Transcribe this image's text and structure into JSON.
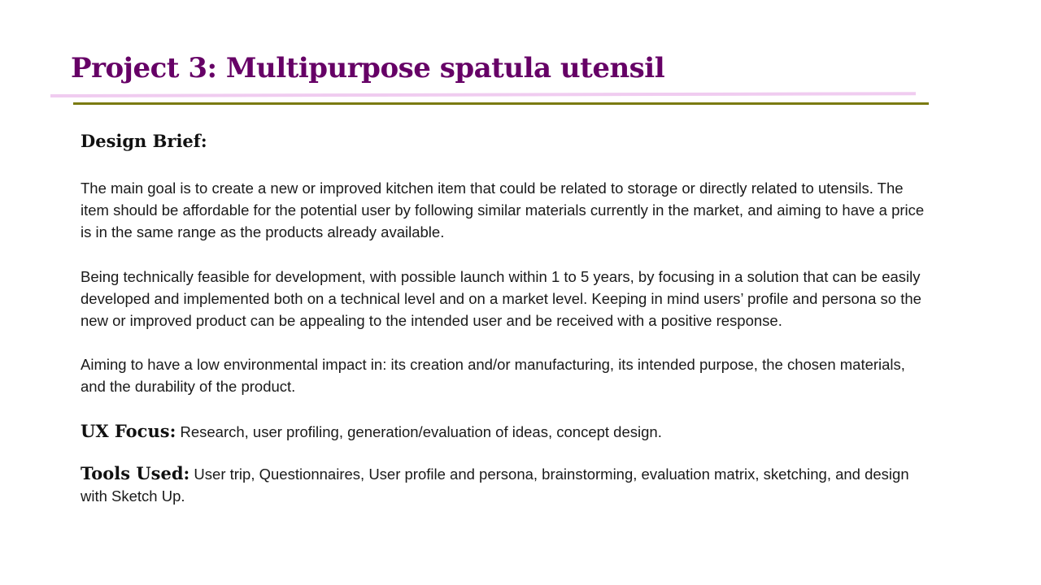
{
  "slide": {
    "title": "Project 3: Multipurpose spatula utensil",
    "design_brief": {
      "heading": "Design Brief:",
      "paragraphs": [
        "The main goal is to create a new or improved kitchen item that could be related to storage or directly related to utensils. The item should be affordable for the potential user by following similar materials currently in the market, and aiming to have a price is in the same range as the products already available.",
        "Being technically feasible for development, with possible launch within 1 to 5 years, by focusing in a solution that can be easily developed and implemented both on a technical level and on a market level. Keeping in mind users’ profile and persona so the new or improved product can be appealing to the intended user and be received with a positive response.",
        "Aiming to have a low environmental impact in:  its creation and/or manufacturing, its intended purpose, the chosen materials, and the durability of the product."
      ]
    },
    "ux_focus": {
      "heading": "UX Focus:",
      "text": "Research, user profiling, generation/evaluation of ideas, concept design."
    },
    "tools_used": {
      "heading": "Tools Used:",
      "text": "User trip, Questionnaires, User profile and persona, brainstorming, evaluation matrix, sketching, and design with Sketch Up."
    }
  },
  "colors": {
    "title": "#660066",
    "rule_pink": "#f0ccf0",
    "rule_olive": "#7a7a10"
  }
}
